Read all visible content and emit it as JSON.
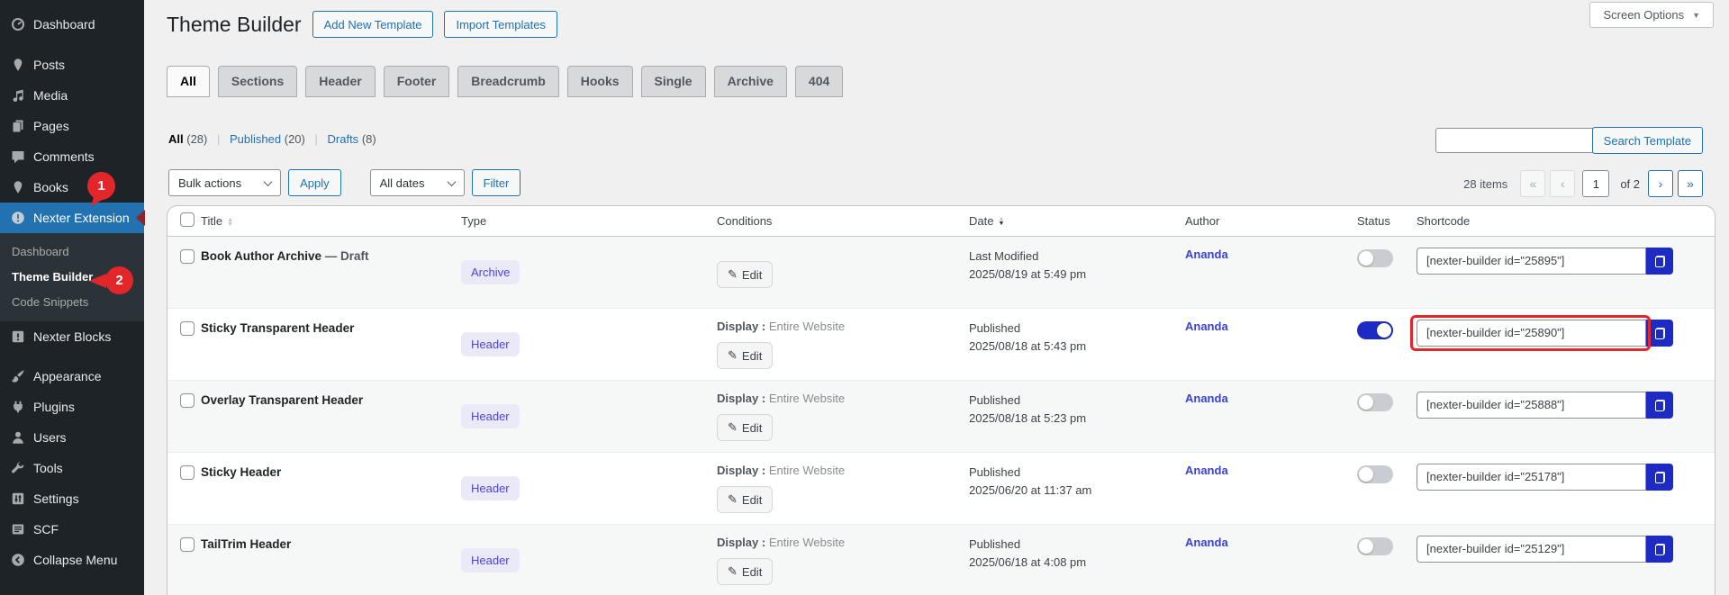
{
  "colors": {
    "accent_blue": "#2271b1",
    "deep_blue": "#1e2ac4",
    "annotation_red": "#e3262a",
    "sidebar_bg": "#1d2327"
  },
  "icons": {
    "pencil": "✎",
    "caret_down": "▼",
    "sort_up": "▲",
    "sort_down": "▼"
  },
  "screen_options": {
    "label": "Screen Options"
  },
  "sidebar": {
    "items": [
      {
        "label": "Dashboard"
      },
      {
        "label": "Posts"
      },
      {
        "label": "Media"
      },
      {
        "label": "Pages"
      },
      {
        "label": "Comments"
      },
      {
        "label": "Books"
      },
      {
        "label": "Nexter Extension",
        "active": true,
        "badge_step": "1"
      },
      {
        "label": "Nexter Blocks"
      },
      {
        "label": "Appearance"
      },
      {
        "label": "Plugins"
      },
      {
        "label": "Users"
      },
      {
        "label": "Tools"
      },
      {
        "label": "Settings"
      },
      {
        "label": "SCF"
      },
      {
        "label": "Collapse Menu"
      }
    ],
    "submenu": [
      {
        "label": "Dashboard"
      },
      {
        "label": "Theme Builder",
        "active": true,
        "badge_step": "2"
      },
      {
        "label": "Code Snippets"
      }
    ]
  },
  "annotations": {
    "step1": "1",
    "step2": "2"
  },
  "header": {
    "title": "Theme Builder",
    "add_new_label": "Add New Template",
    "import_label": "Import Templates"
  },
  "tabs": [
    {
      "label": "All",
      "active": true
    },
    {
      "label": "Sections"
    },
    {
      "label": "Header"
    },
    {
      "label": "Footer"
    },
    {
      "label": "Breadcrumb"
    },
    {
      "label": "Hooks"
    },
    {
      "label": "Single"
    },
    {
      "label": "Archive"
    },
    {
      "label": "404"
    }
  ],
  "filters": {
    "all_label": "All",
    "all_count": "(28)",
    "published_label": "Published",
    "published_count": "(20)",
    "drafts_label": "Drafts",
    "drafts_count": "(8)",
    "separator": "|"
  },
  "search": {
    "input_value": "",
    "button_label": "Search Template"
  },
  "toolbar": {
    "bulk_actions": "Bulk actions",
    "apply": "Apply",
    "all_dates": "All dates",
    "filter": "Filter"
  },
  "pagination": {
    "items_count": "28 items",
    "first": "«",
    "prev": "‹",
    "current_page": "1",
    "of_label": "of 2",
    "next": "›",
    "last": "»"
  },
  "table": {
    "headers": {
      "title": "Title",
      "type": "Type",
      "conditions": "Conditions",
      "date": "Date",
      "author": "Author",
      "status": "Status",
      "shortcode": "Shortcode"
    },
    "edit_label": "Edit",
    "display_label": "Display :",
    "rows": [
      {
        "title": "Book Author Archive",
        "suffix": " — Draft",
        "type": "Archive",
        "display": "",
        "date_line1": "Last Modified",
        "date_line2": "2025/08/19 at 5:49 pm",
        "author": "Ananda",
        "status_on": false,
        "shortcode": "[nexter-builder id=\"25895\"]"
      },
      {
        "title": "Sticky Transparent Header",
        "type": "Header",
        "display": "Entire Website",
        "date_line1": "Published",
        "date_line2": "2025/08/18 at 5:43 pm",
        "author": "Ananda",
        "status_on": true,
        "shortcode": "[nexter-builder id=\"25890\"]",
        "highlighted": true
      },
      {
        "title": "Overlay Transparent Header",
        "type": "Header",
        "display": "Entire Website",
        "date_line1": "Published",
        "date_line2": "2025/08/18 at 5:23 pm",
        "author": "Ananda",
        "status_on": false,
        "shortcode": "[nexter-builder id=\"25888\"]"
      },
      {
        "title": "Sticky Header",
        "type": "Header",
        "display": "Entire Website",
        "date_line1": "Published",
        "date_line2": "2025/06/20 at 11:37 am",
        "author": "Ananda",
        "status_on": false,
        "shortcode": "[nexter-builder id=\"25178\"]"
      },
      {
        "title": "TailTrim Header",
        "type": "Header",
        "display": "Entire Website",
        "date_line1": "Published",
        "date_line2": "2025/06/18 at 4:08 pm",
        "author": "Ananda",
        "status_on": false,
        "shortcode": "[nexter-builder id=\"25129\"]"
      }
    ]
  }
}
